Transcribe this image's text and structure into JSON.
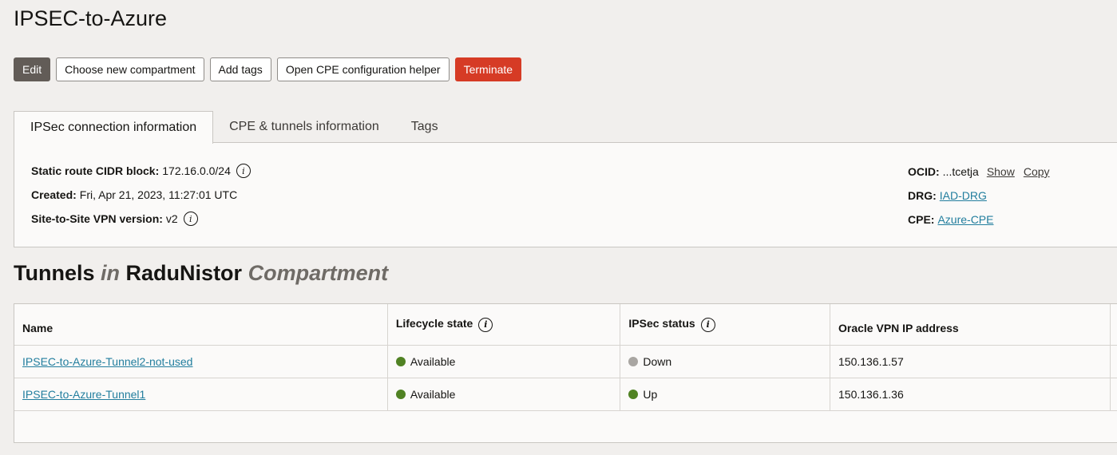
{
  "page": {
    "title": "IPSEC-to-Azure"
  },
  "actions": {
    "edit": "Edit",
    "choose_compartment": "Choose new compartment",
    "add_tags": "Add tags",
    "cpe_helper": "Open CPE configuration helper",
    "terminate": "Terminate"
  },
  "tabs": [
    {
      "label": "IPSec connection information",
      "active": true
    },
    {
      "label": "CPE & tunnels information",
      "active": false
    },
    {
      "label": "Tags",
      "active": false
    }
  ],
  "info": {
    "static_route_label": "Static route CIDR block:",
    "static_route_value": "172.16.0.0/24",
    "created_label": "Created:",
    "created_value": "Fri, Apr 21, 2023, 11:27:01 UTC",
    "vpn_version_label": "Site-to-Site VPN version:",
    "vpn_version_value": "v2",
    "ocid_label": "OCID:",
    "ocid_value": "...tcetja",
    "ocid_show": "Show",
    "ocid_copy": "Copy",
    "drg_label": "DRG:",
    "drg_value": "IAD-DRG",
    "cpe_label": "CPE:",
    "cpe_value": "Azure-CPE"
  },
  "tunnels_section": {
    "title_main": "Tunnels",
    "title_in": "in",
    "compartment_name": "RaduNistor",
    "title_suffix": "Compartment"
  },
  "table": {
    "headers": {
      "name": "Name",
      "lifecycle": "Lifecycle state",
      "ipsec": "IPSec status",
      "ip": "Oracle VPN IP address"
    },
    "rows": [
      {
        "name": "IPSEC-to-Azure-Tunnel2-not-used",
        "lifecycle": "Available",
        "lifecycle_color": "#508223",
        "ipsec": "Down",
        "ipsec_color": "#a9a6a2",
        "ip": "150.136.1.57"
      },
      {
        "name": "IPSEC-to-Azure-Tunnel1",
        "lifecycle": "Available",
        "lifecycle_color": "#508223",
        "ipsec": "Up",
        "ipsec_color": "#508223",
        "ip": "150.136.1.36"
      }
    ]
  },
  "icons": {
    "info": "info-icon",
    "status_dot": "status-dot-icon"
  }
}
